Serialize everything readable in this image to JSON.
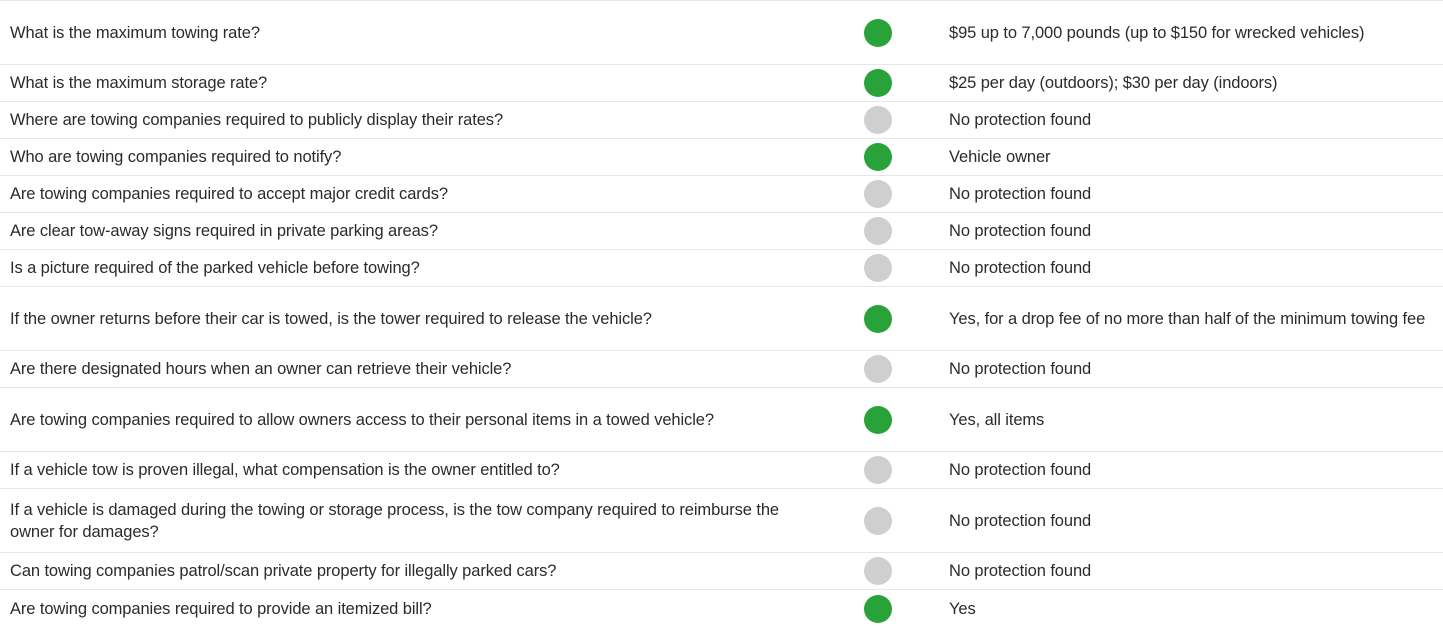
{
  "colors": {
    "green_status": "#2aa23a",
    "gray_status": "#cfcfcf",
    "row_divider": "#e6e6e6",
    "text": "#2b2b2b"
  },
  "rows": [
    {
      "question": "What is the maximum towing rate?",
      "status": "green",
      "answer": "$95 up to 7,000 pounds (up to $150 for wrecked vehicles)"
    },
    {
      "question": "What is the maximum storage rate?",
      "status": "green",
      "answer": "$25 per day (outdoors); $30 per day (indoors)"
    },
    {
      "question": "Where are towing companies required to publicly display their rates?",
      "status": "gray",
      "answer": "No protection found"
    },
    {
      "question": "Who are towing companies required to notify?",
      "status": "green",
      "answer": "Vehicle owner"
    },
    {
      "question": "Are towing companies required to accept major credit cards?",
      "status": "gray",
      "answer": "No protection found"
    },
    {
      "question": "Are clear tow-away signs required in private parking areas?",
      "status": "gray",
      "answer": "No protection found"
    },
    {
      "question": "Is a picture required of the parked vehicle before towing?",
      "status": "gray",
      "answer": "No protection found"
    },
    {
      "question": "If the owner returns before their car is towed, is the tower required to release the vehicle?",
      "status": "green",
      "answer": "Yes, for a drop fee of no more than half of the minimum towing fee"
    },
    {
      "question": "Are there designated hours when an owner can retrieve their vehicle?",
      "status": "gray",
      "answer": "No protection found"
    },
    {
      "question": "Are towing companies required to allow owners access to their personal items in a towed vehicle?",
      "status": "green",
      "answer": "Yes, all items"
    },
    {
      "question": "If a vehicle tow is proven illegal, what compensation is the owner entitled to?",
      "status": "gray",
      "answer": "No protection found"
    },
    {
      "question": "If a vehicle is damaged during the towing or storage process, is the tow company required to reimburse the owner for damages?",
      "status": "gray",
      "answer": "No protection found"
    },
    {
      "question": "Can towing companies patrol/scan private property for illegally parked cars?",
      "status": "gray",
      "answer": "No protection found"
    },
    {
      "question": "Are towing companies required to provide an itemized bill?",
      "status": "green",
      "answer": "Yes"
    }
  ]
}
